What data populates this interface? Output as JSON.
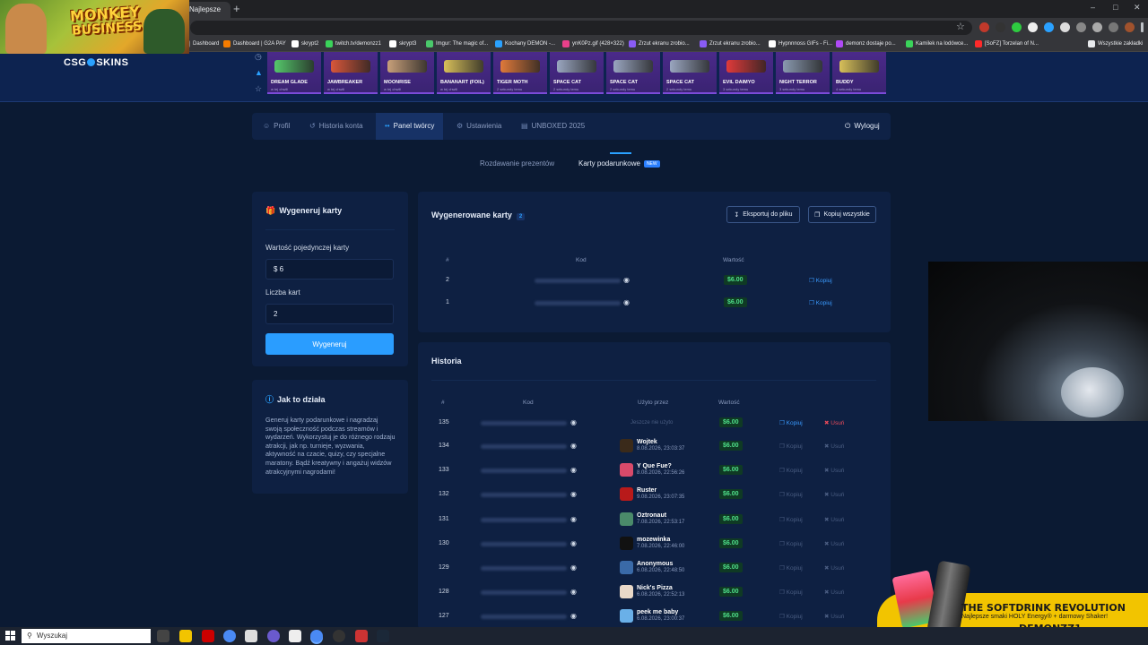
{
  "browser": {
    "tab_label": "Najlepsze",
    "bookmarks": [
      {
        "label": "Dashboard",
        "color": "#7a7a7a"
      },
      {
        "label": "Dashboard | G2A PAY",
        "color": "#f57c00"
      },
      {
        "label": "skrypt2",
        "color": "#ffffff"
      },
      {
        "label": "twitch.tv/demonzz1",
        "color": "#3ad35a"
      },
      {
        "label": "skrypt3",
        "color": "#ffffff"
      },
      {
        "label": "Imgur: The magic of...",
        "color": "#4ac96b"
      },
      {
        "label": "Kochany DEMON -...",
        "color": "#2aa1ff"
      },
      {
        "label": "ynK0Pz.gif (428×322)",
        "color": "#e8408a"
      },
      {
        "label": "Zrzut ekranu zrobio...",
        "color": "#8a5cf6"
      },
      {
        "label": "Zrzut ekranu zrobio...",
        "color": "#8a5cf6"
      },
      {
        "label": "Hypnnnoss GIFs - Fi...",
        "color": "#ffffff"
      },
      {
        "label": "demonz dostaje po...",
        "color": "#b04af6"
      },
      {
        "label": "Kamilek na lodówce...",
        "color": "#3ad35a"
      },
      {
        "label": "[SoFZ] Torzelan of N...",
        "color": "#ff2a2a"
      },
      {
        "label": "Wszystkie zakładki",
        "color": "#e8eaed"
      }
    ]
  },
  "stream_overlay": {
    "logo_line1": "MONKEY",
    "logo_line2": "BUSINESS"
  },
  "site": {
    "logo_left": "CSG",
    "logo_right": "SKINS",
    "live_drops": [
      {
        "name": "DREAM GLADE",
        "sub": "w tej chwili",
        "color": "#55c86b"
      },
      {
        "name": "JAWBREAKER",
        "sub": "w tej chwili",
        "color": "#d9573a"
      },
      {
        "name": "MOONRISE",
        "sub": "w tej chwili",
        "color": "#c8a07a"
      },
      {
        "name": "BANANART (FOIL)",
        "sub": "w tej chwili",
        "color": "#d8c05a"
      },
      {
        "name": "TIGER MOTH",
        "sub": "2 sekundy temu",
        "color": "#e07a3a"
      },
      {
        "name": "SPACE CAT",
        "sub": "2 sekundy temu",
        "color": "#9aa6c0"
      },
      {
        "name": "SPACE CAT",
        "sub": "2 sekundy temu",
        "color": "#9aa6c0"
      },
      {
        "name": "SPACE CAT",
        "sub": "2 sekundy temu",
        "color": "#9aa6c0"
      },
      {
        "name": "EVIL DAIMYO",
        "sub": "3 sekundy temu",
        "color": "#e03a3a"
      },
      {
        "name": "NIGHT TERROR",
        "sub": "3 sekundy temu",
        "color": "#8a9ab0"
      },
      {
        "name": "BUDDY",
        "sub": "4 sekundy temu",
        "color": "#d8c05a"
      }
    ]
  },
  "nav": {
    "profile": "Profil",
    "history": "Historia konta",
    "creator": "Panel twórcy",
    "settings": "Ustawienia",
    "unboxed": "UNBOXED 2025",
    "logout": "Wyloguj"
  },
  "subtabs": {
    "giveaways": "Rozdawanie prezentów",
    "gift_cards": "Karty podarunkowe",
    "new_badge": "NEW"
  },
  "generate": {
    "title": "Wygeneruj karty",
    "value_label": "Wartość pojedynczej karty",
    "value": "$ 6",
    "count_label": "Liczba kart",
    "count": "2",
    "button": "Wygeneruj"
  },
  "how_it_works": {
    "title": "Jak to działa",
    "text": "Generuj karty podarunkowe i nagradzaj swoją społeczność podczas streamów i wydarzeń. Wykorzystuj je do różnego rodzaju atrakcji, jak np. turnieje, wyzwania, aktywność na czacie, quizy, czy specjalne maratony. Bądź kreatywny i angażuj widzów atrakcyjnymi nagrodami!"
  },
  "generated": {
    "title": "Wygenerowane karty",
    "count_badge": "2",
    "export_button": "Eksportuj do pliku",
    "copy_all_button": "Kopiuj wszystkie",
    "columns": {
      "num": "#",
      "code": "Kod",
      "value": "Wartość"
    },
    "rows": [
      {
        "num": "2",
        "value": "$6.00",
        "action": "Kopiuj"
      },
      {
        "num": "1",
        "value": "$6.00",
        "action": "Kopiuj"
      }
    ]
  },
  "history": {
    "title": "Historia",
    "columns": {
      "num": "#",
      "code": "Kod",
      "used_by": "Użyto przez",
      "value": "Wartość"
    },
    "copy_label": "Kopiuj",
    "delete_label": "Usuń",
    "unused_label": "Jeszcze nie użyto",
    "rows": [
      {
        "num": "135",
        "user": "",
        "date": "",
        "value": "$6.00",
        "avatar": ""
      },
      {
        "num": "134",
        "user": "Wojtek",
        "date": "8.08.2026, 23:03:37",
        "value": "$6.00",
        "avatar": "#3a2a1a"
      },
      {
        "num": "133",
        "user": "Y Que Fue?",
        "date": "8.08.2026, 22:56:26",
        "value": "$6.00",
        "avatar": "#d84a6a"
      },
      {
        "num": "132",
        "user": "Ruster",
        "date": "9.08.2026, 23:07:35",
        "value": "$6.00",
        "avatar": "#b81a1a"
      },
      {
        "num": "131",
        "user": "Oztronaut",
        "date": "7.08.2026, 22:53:17",
        "value": "$6.00",
        "avatar": "#4a8a6a"
      },
      {
        "num": "130",
        "user": "mozewinka",
        "date": "7.08.2026, 22:46:00",
        "value": "$6.00",
        "avatar": "#111111"
      },
      {
        "num": "129",
        "user": "Anonymous",
        "date": "6.08.2026, 22:48:50",
        "value": "$6.00",
        "avatar": "#3a6aa8"
      },
      {
        "num": "128",
        "user": "Nick's Pizza",
        "date": "6.08.2026, 22:52:13",
        "value": "$6.00",
        "avatar": "#e8d8c8"
      },
      {
        "num": "127",
        "user": "peek me baby",
        "date": "6.08.2026, 23:00:37",
        "value": "$6.00",
        "avatar": "#6ab0e8"
      }
    ]
  },
  "ad": {
    "headline": "THE SOFTDRINK REVOLUTION",
    "subline": "Najlepsze smaki HOLY Energy® + darmowy Shaker!",
    "code": "DEMONZZ1",
    "fine_print": "10% rabatu z kodem"
  },
  "taskbar": {
    "search_placeholder": "Wyszukaj"
  }
}
